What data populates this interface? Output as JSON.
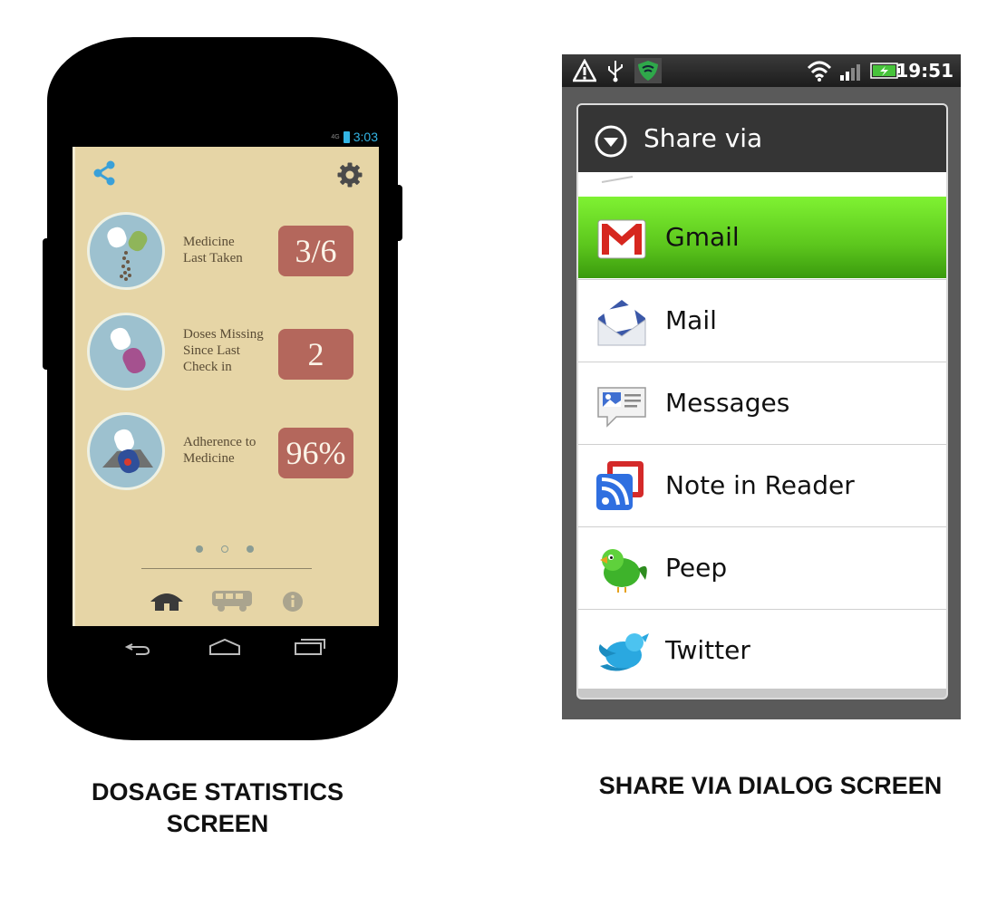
{
  "left_phone": {
    "status_time": "3:03",
    "status_network": "4G",
    "stats": [
      {
        "label": "Medicine\nLast Taken",
        "value": "3/6"
      },
      {
        "label": "Doses Missing\nSince Last\nCheck in",
        "value": "2"
      },
      {
        "label": "Adherence to\nMedicine",
        "value": "96%"
      }
    ]
  },
  "right_phone": {
    "status_time": "19:51",
    "dialog_title": "Share via",
    "options": [
      {
        "label": "Gmail",
        "icon": "gmail-icon",
        "selected": true
      },
      {
        "label": "Mail",
        "icon": "mail-icon"
      },
      {
        "label": "Messages",
        "icon": "messages-icon"
      },
      {
        "label": "Note in Reader",
        "icon": "reader-icon"
      },
      {
        "label": "Peep",
        "icon": "peep-bird-icon"
      },
      {
        "label": "Twitter",
        "icon": "twitter-bird-icon"
      }
    ]
  },
  "captions": {
    "left": "DOSAGE STATISTICS\nSCREEN",
    "right": "SHARE VIA DIALOG SCREEN"
  },
  "colors": {
    "app_background": "#e6d5a6",
    "stat_badge": "#b4675c",
    "pill_disk": "#9dc1cf",
    "status_accent": "#33b5e5",
    "selected_row": "#5cc61d"
  }
}
